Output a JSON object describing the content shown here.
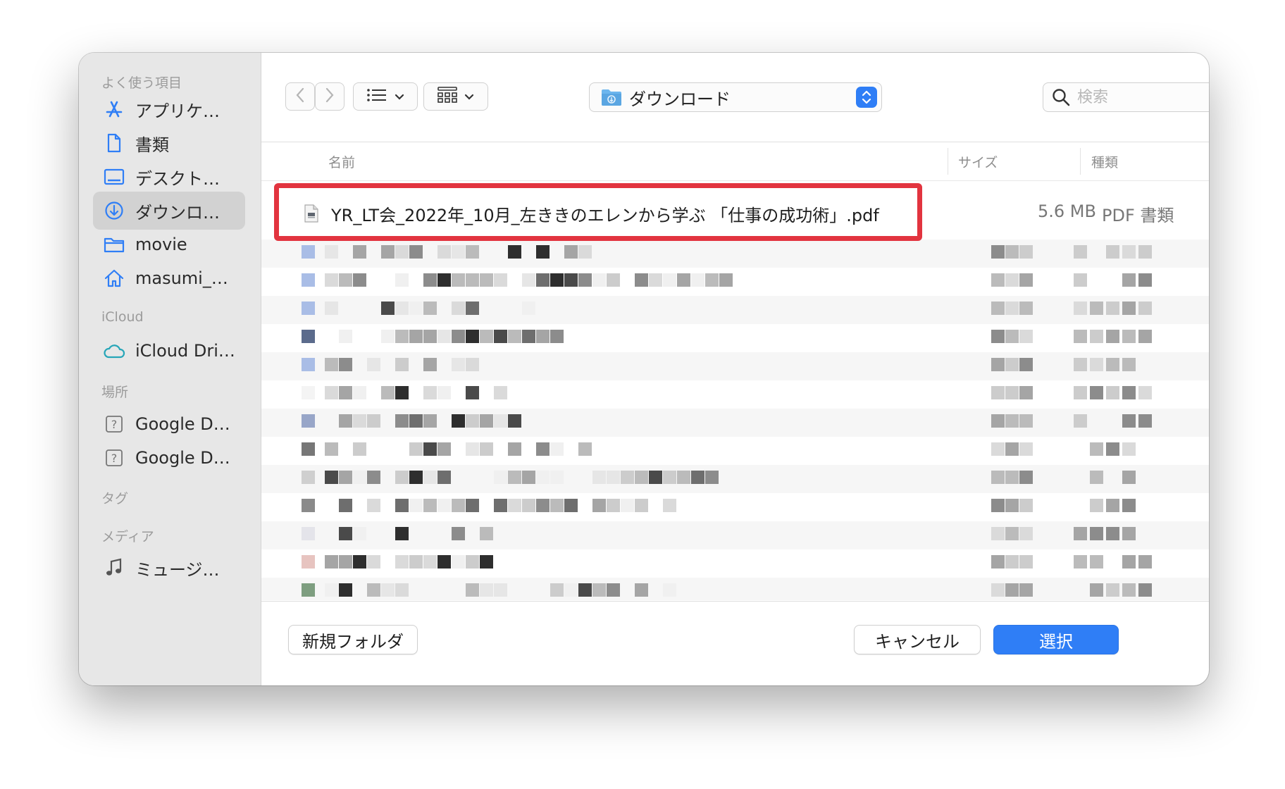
{
  "sidebar": {
    "sections": {
      "favorites": "よく使う項目",
      "icloud": "iCloud",
      "locations": "場所",
      "tags": "タグ",
      "media": "メディア"
    },
    "favorites": [
      {
        "label": "アプリケ…",
        "icon": "app-store-icon"
      },
      {
        "label": "書類",
        "icon": "document-icon"
      },
      {
        "label": "デスクト…",
        "icon": "desktop-icon"
      },
      {
        "label": "ダウンロ…",
        "icon": "download-icon",
        "selected": true
      },
      {
        "label": "movie",
        "icon": "folder-icon"
      },
      {
        "label": "masumi_…",
        "icon": "home-icon"
      }
    ],
    "icloud_items": [
      {
        "label": "iCloud Dri…",
        "icon": "cloud-icon"
      }
    ],
    "locations_items": [
      {
        "label": "Google D…",
        "icon": "unknown-drive-icon"
      },
      {
        "label": "Google D…",
        "icon": "unknown-drive-icon"
      }
    ],
    "media_items": [
      {
        "label": "ミュージ…",
        "icon": "music-note-icon"
      }
    ]
  },
  "toolbar": {
    "location": "ダウンロード",
    "search_placeholder": "検索"
  },
  "list": {
    "columns": {
      "name": "名前",
      "size": "サイズ",
      "kind": "種類"
    },
    "selected_file": {
      "name": "YR_LT会_2022年_10月_左ききのエレンから学ぶ 「仕事の成功術」.pdf",
      "size": "5.6 MB",
      "kind": "PDF 書類"
    }
  },
  "footer": {
    "new_folder": "新規フォルダ",
    "cancel": "キャンセル",
    "select": "選択"
  },
  "colors": {
    "accent": "#2f7ef6",
    "highlight": "#e2343f",
    "sidebar_bg": "#e7e7e7"
  }
}
